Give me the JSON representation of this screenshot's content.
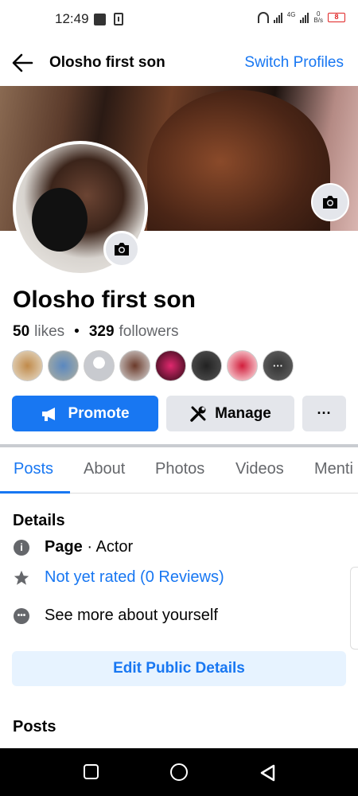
{
  "status_bar": {
    "time": "12:49",
    "network": "4G",
    "speed": "0\nB/s",
    "battery": "8"
  },
  "header": {
    "title": "Olosho first son",
    "switch_label": "Switch Profiles"
  },
  "profile": {
    "name": "Olosho first son",
    "likes_count": "50",
    "likes_label": "likes",
    "separator": "•",
    "followers_count": "329",
    "followers_label": "followers"
  },
  "actions": {
    "promote_label": "Promote",
    "manage_label": "Manage",
    "more_label": "···"
  },
  "tabs": [
    {
      "label": "Posts"
    },
    {
      "label": "About"
    },
    {
      "label": "Photos"
    },
    {
      "label": "Videos"
    },
    {
      "label": "Menti"
    }
  ],
  "details": {
    "title": "Details",
    "category_bold": "Page",
    "category_rest": " · Actor",
    "rating": "Not yet rated (0 Reviews)",
    "see_more": "See more about yourself",
    "edit_label": "Edit Public Details"
  },
  "posts": {
    "title": "Posts"
  },
  "colors": {
    "accent": "#1877f2",
    "button_bg": "#e4e6eb",
    "edit_bg": "#e7f3ff"
  }
}
